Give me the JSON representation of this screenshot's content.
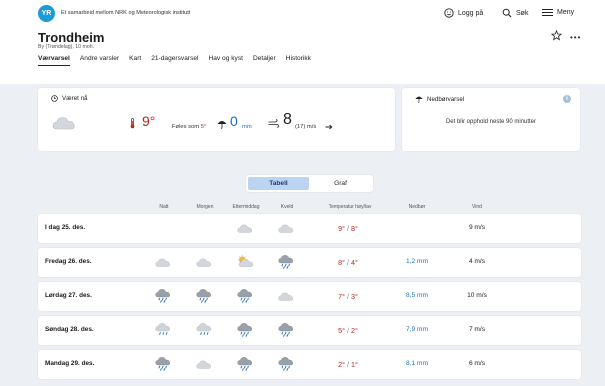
{
  "header": {
    "logo_text": "YR",
    "collab_text": "Et samarbeid mellom NRK og Meteorologisk institutt",
    "nav": {
      "logg_pa": "Logg på",
      "sok": "Søk",
      "meny": "Meny"
    }
  },
  "location": {
    "name": "Trondheim",
    "subtitle": "By (Trøndelag), 10 moh."
  },
  "tabs": [
    "Værvarsel",
    "Andre varsler",
    "Kart",
    "21-dagersvarsel",
    "Hav og kyst",
    "Detaljer",
    "Historikk"
  ],
  "now": {
    "title": "Været nå",
    "temp": "9°",
    "feels_label": "Føles som",
    "feels_value": "5°",
    "precip": "0",
    "precip_unit": "mm",
    "wind": "8",
    "gust": "(17) m/s"
  },
  "precip_card": {
    "title": "Nedbørvarsel",
    "info": "i",
    "text": "Det blir opphold neste 90 minutter"
  },
  "view_toggle": {
    "tabell": "Tabell",
    "graf": "Graf"
  },
  "table": {
    "headers": {
      "natt": "Natt",
      "morgen": "Morgen",
      "ettermiddag": "Ettermiddag",
      "kveld": "Kveld",
      "temp": "Temperatur høy/lav",
      "nedbor": "Nedbør",
      "vind": "Vind"
    },
    "rows": [
      {
        "day": "I dag 25. des.",
        "icons": [
          null,
          null,
          "cloud-icon",
          "cloud-icon"
        ],
        "high": "9°",
        "low": "8°",
        "precip": "",
        "wind": "9 m/s"
      },
      {
        "day": "Fredag 26. des.",
        "icons": [
          "cloud-icon",
          "cloud-icon",
          "partly-sunny-icon",
          "rain-cloud-icon"
        ],
        "high": "8°",
        "low": "4°",
        "precip": "1,2 mm",
        "wind": "4 m/s"
      },
      {
        "day": "Lørdag 27. des.",
        "icons": [
          "rain-cloud-icon",
          "rain-cloud-icon",
          "rain-cloud-icon",
          "cloud-icon"
        ],
        "high": "7°",
        "low": "3°",
        "precip": "8,5 mm",
        "wind": "10 m/s"
      },
      {
        "day": "Søndag 28. des.",
        "icons": [
          "light-rain-cloud-icon",
          "light-rain-cloud-icon",
          "rain-cloud-icon",
          "rain-cloud-icon"
        ],
        "high": "5°",
        "low": "2°",
        "precip": "7,9 mm",
        "wind": "7 m/s"
      },
      {
        "day": "Mandag 29. des.",
        "icons": [
          "rain-cloud-icon",
          "cloud-icon",
          "rain-cloud-icon",
          "rain-cloud-icon"
        ],
        "high": "2°",
        "low": "1°",
        "precip": "8,1 mm",
        "wind": "6 m/s"
      }
    ]
  },
  "colors": {
    "temp": "#b5291f",
    "precip": "#1c6dc4",
    "accent": "#1e9bd4",
    "toggle_active": "#bcd3f2",
    "background": "#ecf0f5"
  }
}
